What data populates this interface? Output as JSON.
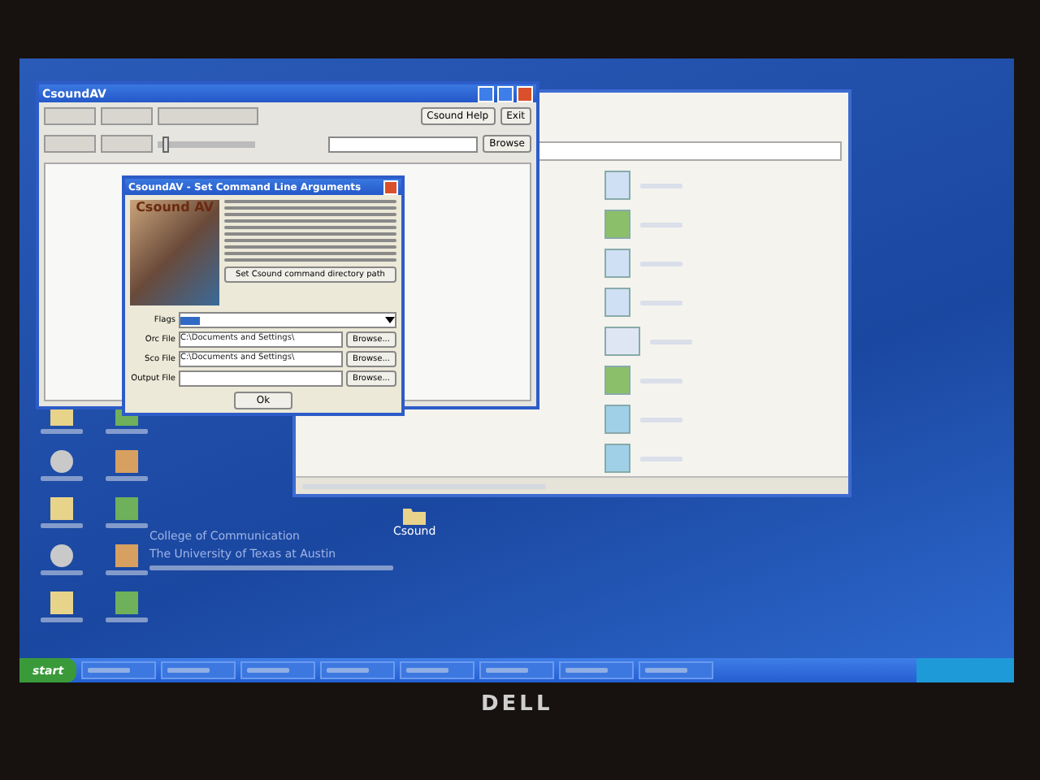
{
  "main_window": {
    "title": "CsoundAV",
    "buttons": [
      {
        "label": "Csound Help"
      },
      {
        "label": "Exit"
      }
    ],
    "browse": "Browse",
    "slider": {
      "level": 0.05
    }
  },
  "dialog": {
    "title": "CsoundAV - Set Command Line Arguments",
    "logo": "Csound AV",
    "path_button": "Set Csound command directory path",
    "fields": [
      {
        "label": "Flags",
        "kind": "dropdown"
      },
      {
        "label": "Orc File",
        "value": "C:\\Documents and Settings\\",
        "kind": "file",
        "browse": "Browse..."
      },
      {
        "label": "Sco File",
        "value": "C:\\Documents and Settings\\",
        "kind": "file",
        "browse": "Browse..."
      },
      {
        "label": "Output File",
        "kind": "file",
        "browse": "Browse..."
      }
    ],
    "ok": "Ok"
  },
  "explorer": {
    "files": [
      {
        "kind": "audio"
      },
      {
        "kind": "app"
      },
      {
        "kind": "audio"
      },
      {
        "kind": "audio"
      },
      {
        "kind": "window"
      },
      {
        "kind": "app"
      },
      {
        "kind": "doc"
      },
      {
        "kind": "doc"
      }
    ]
  },
  "desktop_text": [
    "College of Communication",
    "The University of Texas at Austin"
  ],
  "desktop_folder": "Csound",
  "taskbar": {
    "start": "start"
  },
  "bezel_logo": "DELL"
}
